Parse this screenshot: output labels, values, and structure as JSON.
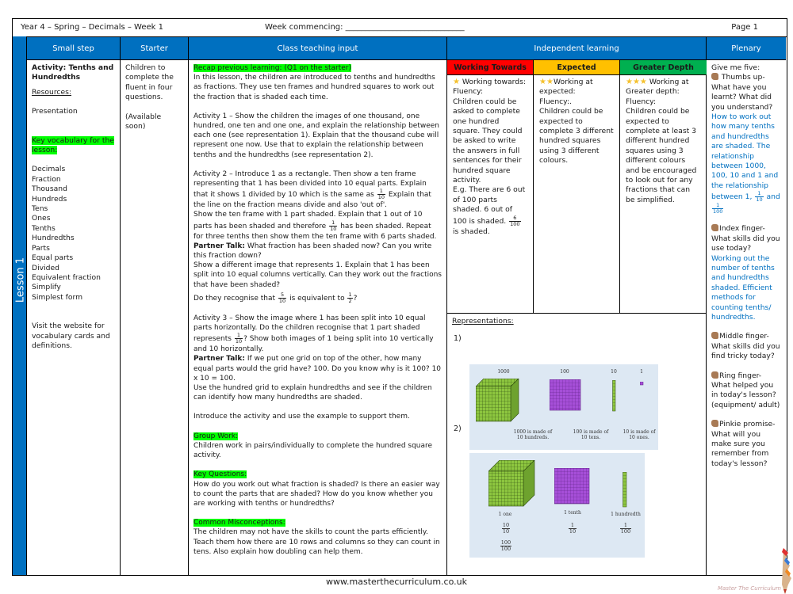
{
  "header": {
    "title": "Year 4 – Spring – Decimals – Week 1",
    "week_commencing": "Week commencing: ______________________________",
    "page": "Page 1"
  },
  "sidebar": {
    "lesson_label": "Lesson 1"
  },
  "columns": {
    "small_step": "Small step",
    "starter": "Starter",
    "class_teaching": "Class teaching input",
    "independent": "Independent learning",
    "plenary": "Plenary"
  },
  "small_step": {
    "activity_title": "Activity: Tenths and Hundredths",
    "resources_label": "Resources:",
    "resources": "Presentation",
    "vocab_label": "Key vocabulary for the lesson:",
    "vocabulary": [
      "Decimals",
      "Fraction",
      "Thousand",
      "Hundreds",
      "Tens",
      "Ones",
      "Tenths",
      "Hundredths",
      "Parts",
      "Equal parts",
      "Divided",
      "Equivalent fraction",
      "Simplify",
      "Simplest form"
    ],
    "website_note": "Visit the website for vocabulary cards and definitions."
  },
  "starter": {
    "text": "Children to complete the fluent in four questions.",
    "availability": "(Available soon)"
  },
  "class_teaching": {
    "recap": "Recap previous learning: (Q1 on the starter)",
    "intro": "In this lesson, the children are introduced to tenths and hundredths as fractions. They use ten frames and hundred squares to work out the fraction that is shaded each time.",
    "activity1": "Activity 1 – Show the children the images of one thousand, one hundred, one ten and one one, and explain the relationship between each one (see representation 1). Explain that the thousand cube will represent one now. Use that to explain the relationship between tenths and the hundredths (see representation 2).",
    "activity2_a": "Activity 2 – Introduce 1 as a rectangle. Then show a ten frame representing that 1 has been divided into 10 equal parts. Explain that it shows 1 divided by 10 which is the same as",
    "activity2_b": "Explain that the line on the fraction means divide and also 'out of'.",
    "activity2_c": "Show the ten frame with 1 part shaded. Explain that 1 out of 10 parts has been shaded and therefore",
    "activity2_d": "has been shaded. Repeat for three tenths then show them the ten frame with 6 parts shaded.",
    "partner_talk_label": "Partner Talk:",
    "partner_talk1": "What fraction has been shaded now? Can you write this fraction down?",
    "activity2_e": "Show a different image that represents 1. Explain that 1 has been split into 10 equal columns vertically. Can they work out the fractions that have been shaded?",
    "recognise_a": "Do they recognise that",
    "recognise_b": "is equivalent to",
    "activity3_a": "Activity 3 – Show the image where 1 has been split into 10 equal parts horizontally. Do the children recognise that 1 part shaded represents",
    "activity3_b": "Show both images of 1 being split into 10 vertically and 10 horizontally.",
    "partner_talk2": "If we put one grid on top of the other, how many equal parts would the grid have? 100. Do you know why is it 100? 10 x 10 = 100.",
    "activity3_c": "Use the hundred grid to explain hundredths and see if the children can identify how many hundredths are shaded.",
    "introduce": "Introduce the activity and use the example to support them.",
    "group_work_label": "Group Work:",
    "group_work": "Children work in pairs/individually to complete the hundred square activity.",
    "key_questions_label": "Key Questions:",
    "key_questions": "How do you work out what fraction is shaded? Is there an easier way to count the parts that are shaded? How do you know whether you are working with tenths or hundredths?",
    "misconceptions_label": "Common Misconceptions:",
    "misconceptions": "The children may not have the skills to count the parts efficiently. Teach them how there are 10 rows and columns so they can count in tens. Also explain how doubling can help them.",
    "fractions": {
      "one_tenth": {
        "n": "1",
        "d": "10"
      },
      "five_tenths": {
        "n": "5",
        "d": "10"
      },
      "one_half": {
        "n": "1",
        "d": "2"
      }
    }
  },
  "independent": {
    "levels": [
      {
        "label": "Working Towards",
        "color": "#ff0000"
      },
      {
        "label": "Expected",
        "color": "#ffc000"
      },
      {
        "label": "Greater Depth",
        "color": "#00b050"
      }
    ],
    "working_towards": {
      "stars": "★",
      "title": "Working towards:",
      "fluency": "Fluency:",
      "text": "Children could be asked to complete one hundred square. They could be asked to write the answers in full sentences for their hundred square activity.",
      "example_a": "E.g. There are 6 out of 100 parts shaded. 6 out of 100 is shaded.",
      "example_frac": {
        "n": "6",
        "d": "100"
      },
      "example_b": "is shaded."
    },
    "expected": {
      "stars": "★★",
      "title": "Working at expected:",
      "fluency": "Fluency:.",
      "text": "Children could be expected to complete 3 different hundred squares using 3 different colours."
    },
    "greater_depth": {
      "stars": "★★★",
      "title": "Working at Greater depth:",
      "fluency": "Fluency:",
      "text": "Children could be expected to complete at least 3 different hundred squares using 3 different colours and be encouraged to look out for any fractions that can be simplified."
    },
    "representations": {
      "label": "Representations:",
      "rep1_num": "1)",
      "rep2_num": "2)",
      "rep1_labels": [
        "1000",
        "100",
        "10",
        "1"
      ],
      "rep1_captions": [
        "1000 is made of 10 hundreds.",
        "100 is made of 10 tens.",
        "10 is made of 10 ones."
      ],
      "rep2_captions": [
        "1 one",
        "1 tenth",
        "1 hundredth"
      ],
      "rep2_fracs": {
        "one_a": {
          "n": "10",
          "d": "10"
        },
        "one_b": {
          "n": "100",
          "d": "100"
        },
        "tenth": {
          "n": "1",
          "d": "10"
        },
        "hundredth": {
          "n": "1",
          "d": "100"
        }
      }
    }
  },
  "plenary": {
    "intro": "Give me five:",
    "thumbs": "Thumbs up- What have you learnt? What did you understand?",
    "thumbs_answer_a": "How to work out how many tenths and hundredths are shaded. The relationship between 1000, 100, 10 and 1 and the relationship between 1,",
    "thumbs_answer_b": "and",
    "thumbs_fracs": {
      "tenth": {
        "n": "1",
        "d": "10"
      },
      "hundredth": {
        "n": "1",
        "d": "100"
      }
    },
    "index": "Index finger- What skills did you use today?",
    "index_answer": "Working out the number of tenths and hundredths shaded. Efficient methods for counting tenths/ hundredths.",
    "middle": "Middle finger- What skills did you find tricky today?",
    "ring": "Ring finger- What helped you in today's lesson? (equipment/ adult)",
    "pinkie": "Pinkie promise- What will you make sure you remember from today's lesson?"
  },
  "footer": {
    "url": "www.masterthecurriculum.co.uk",
    "brand": "Master The Curriculum"
  }
}
